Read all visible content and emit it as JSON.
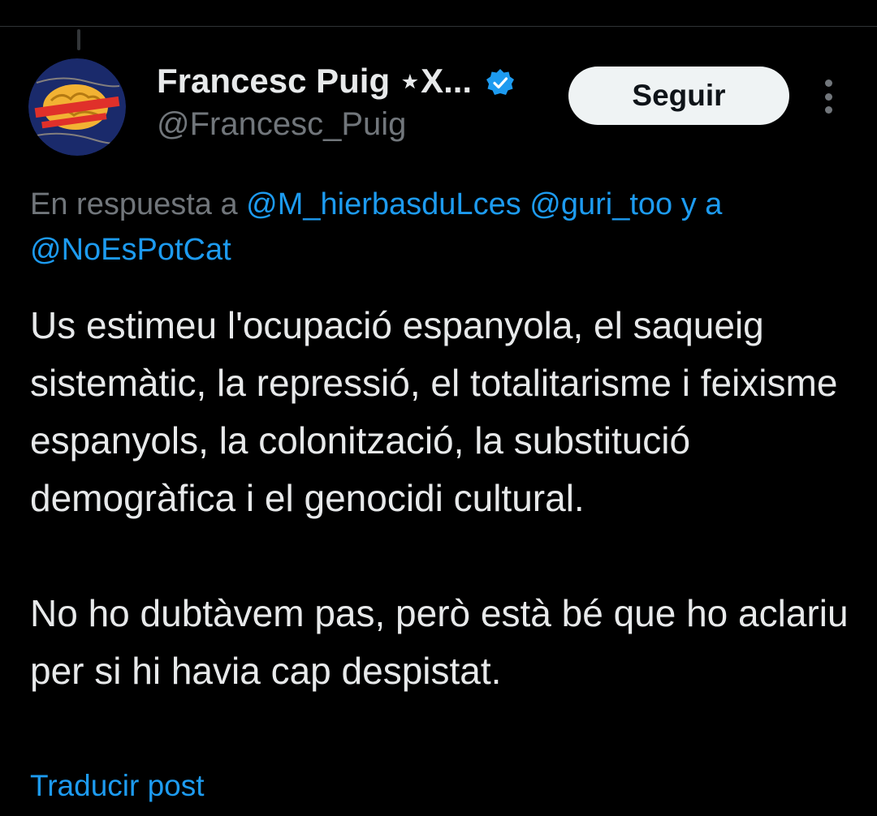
{
  "author": {
    "display_name": "Francesc Puig ⋆X...",
    "handle": "@Francesc_Puig",
    "avatar_icon": "brain-avatar-icon",
    "verified_icon": "verified-badge-icon"
  },
  "actions": {
    "follow_label": "Seguir",
    "more_icon": "more-options-icon"
  },
  "reply": {
    "prefix": "En respuesta a",
    "mentions": [
      "@M_hierbasduLces",
      "@guri_too"
    ],
    "joiner": "y a",
    "last_mention": "@NoEsPotCat"
  },
  "tweet": {
    "paragraphs": [
      "Us estimeu l'ocupació espanyola, el saqueig sistemàtic, la repressió, el totalitarisme i feixisme espanyols, la colonització, la substitució demogràfica i el genocidi cultural.",
      "No ho dubtàvem pas, però està bé que ho aclariu per si hi havia cap despistat."
    ],
    "translate_label": "Traducir post"
  },
  "colors": {
    "background": "#000000",
    "text": "#e7e9ea",
    "secondary": "#71767b",
    "link": "#1d9bf0",
    "follow_bg": "#eff3f4"
  }
}
